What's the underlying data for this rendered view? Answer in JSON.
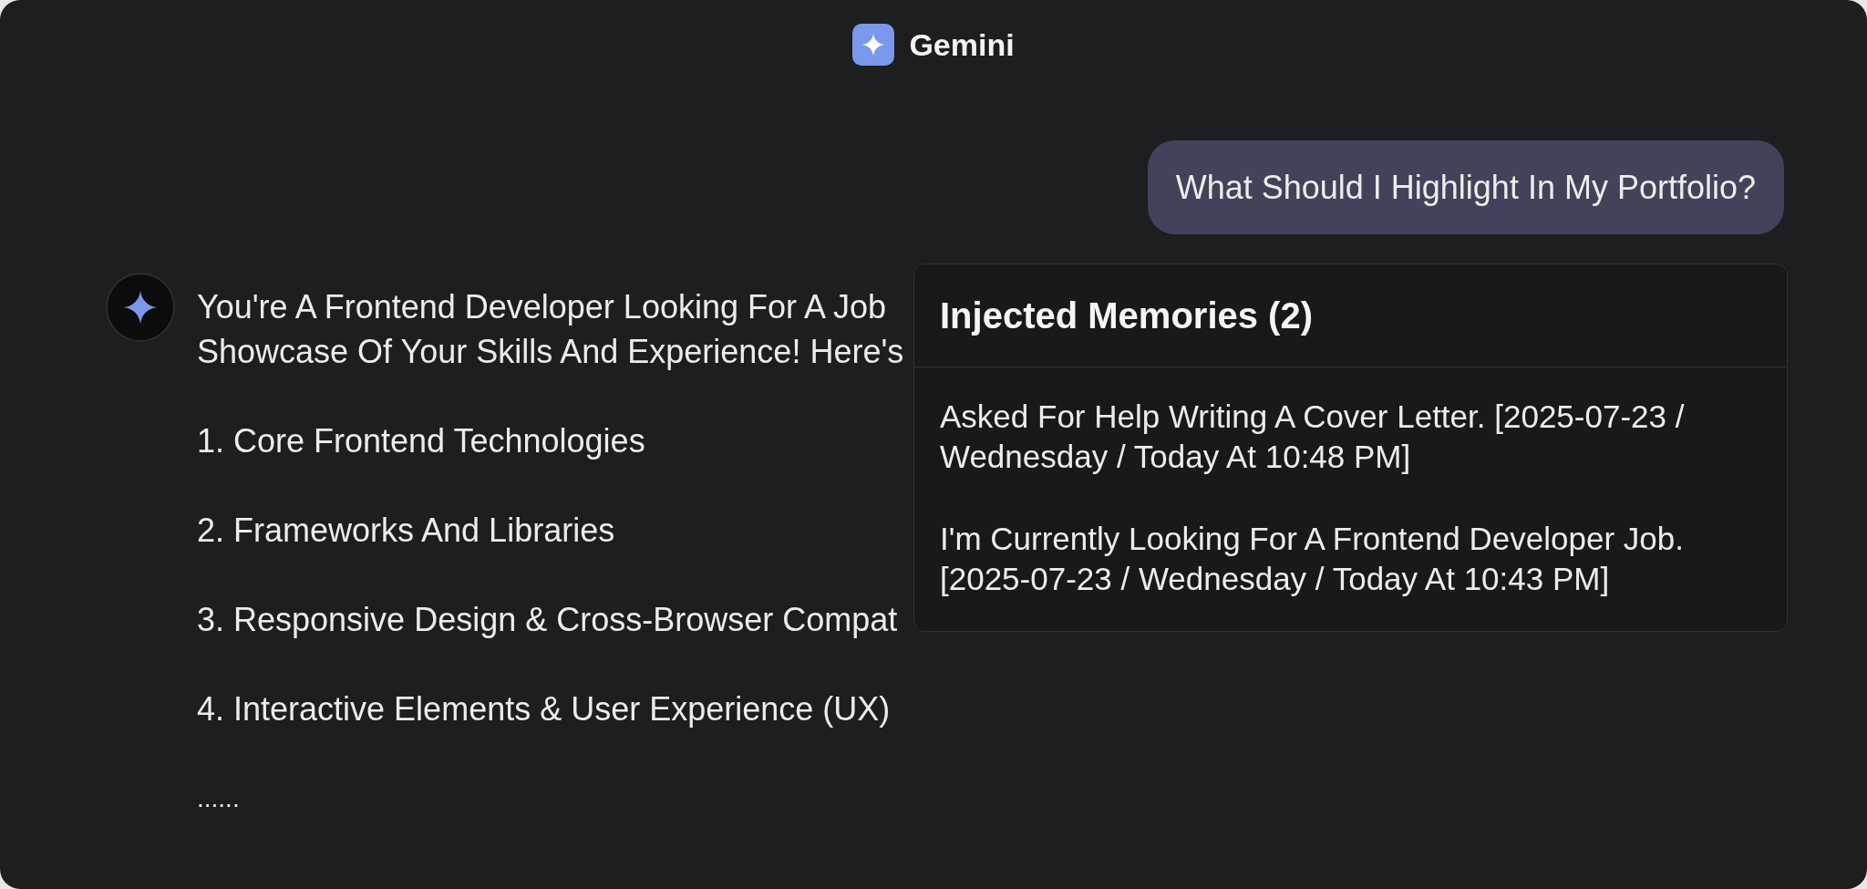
{
  "header": {
    "title": "Gemini"
  },
  "user_message": {
    "text": "What Should I Highlight In My Portfolio?"
  },
  "assistant_message": {
    "intro_lines": [
      "You're A Frontend Developer Looking For A Job",
      "Showcase Of Your Skills And Experience! Here's"
    ],
    "points": [
      "1. Core Frontend Technologies",
      "2. Frameworks And Libraries",
      "3. Responsive Design & Cross-Browser Compat",
      "4. Interactive Elements & User Experience (UX)"
    ],
    "ellipsis": "......"
  },
  "memories_popup": {
    "title": "Injected Memories (2)",
    "items": [
      "Asked For Help Writing A Cover Letter. [2025-07-23 / Wednesday / Today At 10:48 PM]",
      "I'm Currently Looking For A Frontend Developer Job. [2025-07-23 / Wednesday / Today At 10:43 PM]"
    ]
  }
}
